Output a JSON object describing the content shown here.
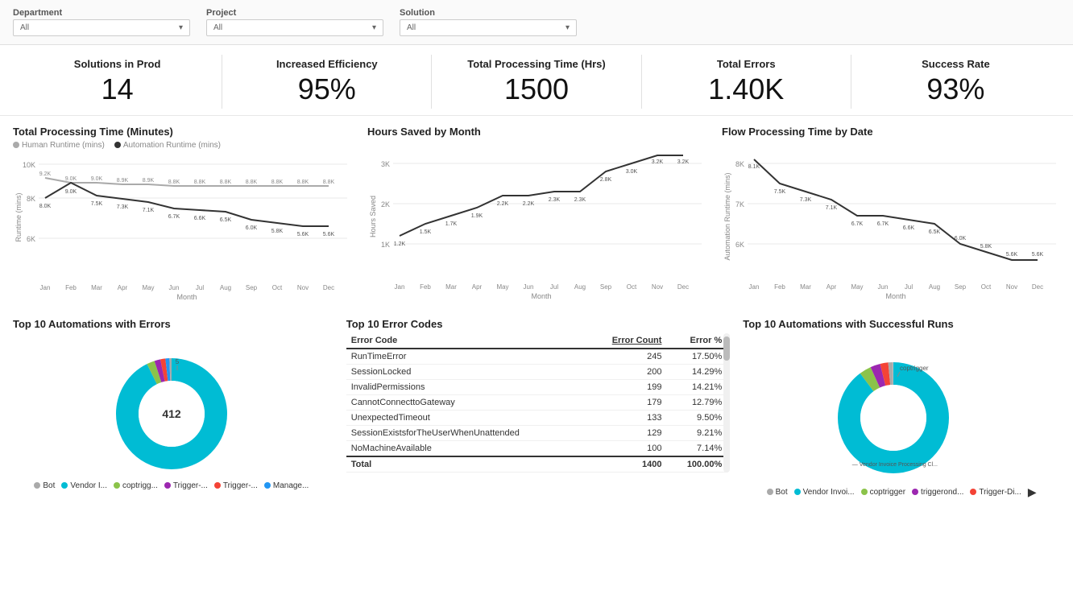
{
  "filters": [
    {
      "label": "Department",
      "value": "All"
    },
    {
      "label": "Project",
      "value": "All"
    },
    {
      "label": "Solution",
      "value": "All"
    }
  ],
  "kpis": [
    {
      "title": "Solutions in Prod",
      "value": "14"
    },
    {
      "title": "Increased Efficiency",
      "value": "95%"
    },
    {
      "title": "Total Processing Time (Hrs)",
      "value": "1500"
    },
    {
      "title": "Total Errors",
      "value": "1.40K"
    },
    {
      "title": "Success Rate",
      "value": "93%"
    }
  ],
  "charts": {
    "processing_time": {
      "title": "Total Processing Time (Minutes)",
      "legend": [
        {
          "label": "Human Runtime (mins)",
          "color": "#aaa"
        },
        {
          "label": "Automation Runtime (mins)",
          "color": "#333"
        }
      ]
    },
    "hours_saved": {
      "title": "Hours Saved by Month"
    },
    "flow_processing": {
      "title": "Flow Processing Time by Date"
    }
  },
  "error_codes": {
    "title": "Top 10 Error Codes",
    "columns": [
      "Error Code",
      "Error Count",
      "Error %"
    ],
    "rows": [
      {
        "code": "RunTimeError",
        "count": "245",
        "pct": "17.50%"
      },
      {
        "code": "SessionLocked",
        "count": "200",
        "pct": "14.29%"
      },
      {
        "code": "InvalidPermissions",
        "count": "199",
        "pct": "14.21%"
      },
      {
        "code": "CannotConnecttoGateway",
        "count": "179",
        "pct": "12.79%"
      },
      {
        "code": "UnexpectedTimeout",
        "count": "133",
        "pct": "9.50%"
      },
      {
        "code": "SessionExistsforTheUserWhenUnattended",
        "count": "129",
        "pct": "9.21%"
      },
      {
        "code": "NoMachineAvailable",
        "count": "100",
        "pct": "7.14%"
      }
    ],
    "total": {
      "label": "Total",
      "count": "1400",
      "pct": "100.00%"
    }
  },
  "donut_errors": {
    "title": "Top 10 Automations with Errors",
    "center_value": "412",
    "top_value": "5",
    "legend": [
      {
        "label": "Bot",
        "color": "#999"
      },
      {
        "label": "Vendor I...",
        "color": "#00bcd4"
      },
      {
        "label": "coptrigg...",
        "color": "#8bc34a"
      },
      {
        "label": "Trigger-...",
        "color": "#9c27b0"
      },
      {
        "label": "Trigger-...",
        "color": "#f44336"
      },
      {
        "label": "Manage...",
        "color": "#2196f3"
      }
    ]
  },
  "donut_success": {
    "title": "Top 10 Automations with Successful Runs",
    "label": "coptrigger",
    "vendor_label": "— Vendor Invoice Processing Cl...",
    "legend": [
      {
        "label": "Bot",
        "color": "#999"
      },
      {
        "label": "Vendor Invoi...",
        "color": "#00bcd4"
      },
      {
        "label": "coptrigger",
        "color": "#8bc34a"
      },
      {
        "label": "triggerond...",
        "color": "#9c27b0"
      },
      {
        "label": "Trigger-Di...",
        "color": "#f44336"
      }
    ]
  }
}
